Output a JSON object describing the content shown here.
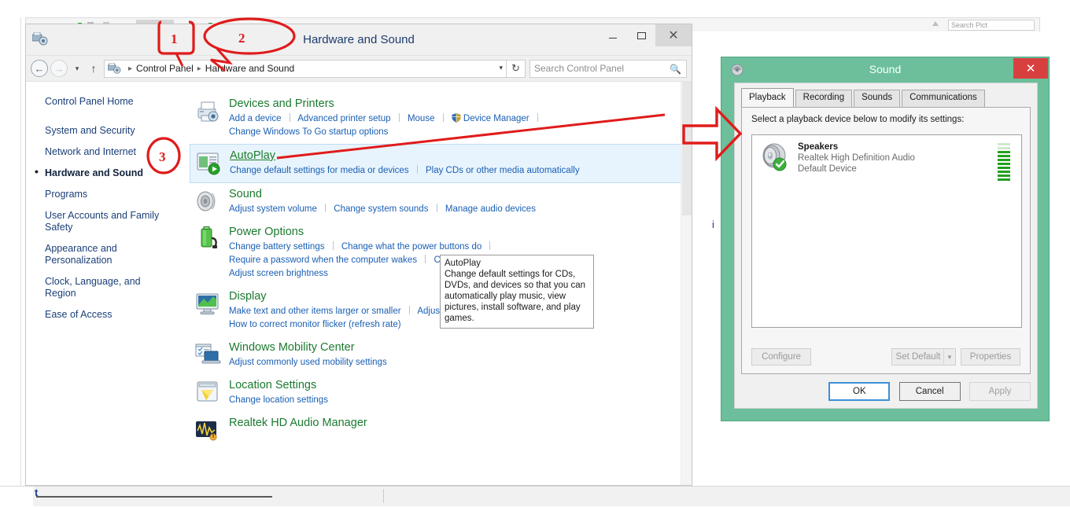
{
  "background": {
    "search_placeholder": "Search Pict",
    "fragment_text": "i"
  },
  "control_panel": {
    "title": "Hardware and Sound",
    "icon": "control-panel-icon",
    "window_buttons": {
      "minimize": "minimize-icon",
      "maximize": "maximize-icon",
      "close": "✕"
    },
    "address": {
      "back": "←",
      "forward": "→",
      "recent": "▾",
      "up": "↑",
      "icon": "control-panel-icon",
      "crumbs": [
        "Control Panel",
        "Hardware and Sound"
      ],
      "separator": "▸",
      "dropdown": "▾",
      "refresh": "↻"
    },
    "search": {
      "placeholder": "Search Control Panel",
      "icon": "search-icon"
    },
    "sidebar": {
      "home": "Control Panel Home",
      "items": [
        {
          "label": "System and Security",
          "active": false
        },
        {
          "label": "Network and Internet",
          "active": false
        },
        {
          "label": "Hardware and Sound",
          "active": true
        },
        {
          "label": "Programs",
          "active": false
        },
        {
          "label": "User Accounts and Family Safety",
          "active": false
        },
        {
          "label": "Appearance and Personalization",
          "active": false
        },
        {
          "label": "Clock, Language, and Region",
          "active": false
        },
        {
          "label": "Ease of Access",
          "active": false
        }
      ]
    },
    "categories": [
      {
        "icon": "devices-printers-icon",
        "title": "Devices and Printers",
        "highlighted": false,
        "underlined": false,
        "links_row1": [
          "Add a device",
          "Advanced printer setup",
          "Mouse",
          "Device Manager"
        ],
        "shield_on": "Device Manager",
        "links_row2": [
          "Change Windows To Go startup options"
        ]
      },
      {
        "icon": "autoplay-icon",
        "title": "AutoPlay",
        "highlighted": true,
        "underlined": true,
        "links_row1": [
          "Change default settings for media or devices",
          "Play CDs or other media automatically"
        ],
        "shield_on": "",
        "links_row2": []
      },
      {
        "icon": "sound-speaker-icon",
        "title": "Sound",
        "highlighted": false,
        "underlined": false,
        "links_row1": [
          "Adjust system volume",
          "Change system sounds",
          "Manage audio devices"
        ],
        "shield_on": "",
        "links_row2": []
      },
      {
        "icon": "power-battery-icon",
        "title": "Power Options",
        "highlighted": false,
        "underlined": false,
        "links_row1": [
          "Change battery settings",
          "Change what the power buttons do"
        ],
        "shield_on": "",
        "links_row2": [
          "Require a password when the computer wakes",
          "Change when the computer sleeps"
        ],
        "links_row3": [
          "Adjust screen brightness"
        ]
      },
      {
        "icon": "display-monitor-icon",
        "title": "Display",
        "highlighted": false,
        "underlined": false,
        "links_row1": [
          "Make text and other items larger or smaller",
          "Adjust screen resolution"
        ],
        "shield_on": "",
        "links_row2": [
          "How to correct monitor flicker (refresh rate)"
        ]
      },
      {
        "icon": "mobility-center-icon",
        "title": "Windows Mobility Center",
        "highlighted": false,
        "underlined": false,
        "links_row1": [
          "Adjust commonly used mobility settings"
        ],
        "shield_on": "",
        "links_row2": []
      },
      {
        "icon": "location-settings-icon",
        "title": "Location Settings",
        "highlighted": false,
        "underlined": false,
        "links_row1": [
          "Change location settings"
        ],
        "shield_on": "",
        "links_row2": []
      },
      {
        "icon": "realtek-audio-icon",
        "title": "Realtek HD Audio Manager",
        "highlighted": false,
        "underlined": false,
        "links_row1": [],
        "shield_on": "",
        "links_row2": []
      }
    ],
    "tooltip": {
      "title": "AutoPlay",
      "body": "Change default settings for CDs, DVDs, and devices so that you can automatically play music, view pictures, install software, and play games."
    }
  },
  "sound_dialog": {
    "title": "Sound",
    "icon": "sound-dialog-icon",
    "close": "✕",
    "titlebar_color": "#6cbf9a",
    "close_color": "#d8403f",
    "tabs": [
      {
        "label": "Playback",
        "active": true
      },
      {
        "label": "Recording",
        "active": false
      },
      {
        "label": "Sounds",
        "active": false
      },
      {
        "label": "Communications",
        "active": false
      }
    ],
    "instruction": "Select a playback device below to modify its settings:",
    "devices": [
      {
        "name": "Speakers",
        "driver": "Realtek High Definition Audio",
        "status": "Default Device",
        "icon": "speaker-icon",
        "badge": "default-check-badge",
        "meter_level": 8,
        "meter_total": 10
      }
    ],
    "panel_buttons": [
      {
        "label": "Configure",
        "enabled": false
      },
      {
        "label": "Set Default",
        "enabled": false,
        "has_dropdown": true
      },
      {
        "label": "Properties",
        "enabled": false
      }
    ],
    "footer_buttons": [
      {
        "label": "OK",
        "enabled": true,
        "primary": true
      },
      {
        "label": "Cancel",
        "enabled": true,
        "primary": false
      },
      {
        "label": "Apply",
        "enabled": false,
        "primary": false
      }
    ]
  },
  "annotations": {
    "color": "#e01b1b",
    "markers": [
      {
        "label": "1",
        "shape": "rounded-rect"
      },
      {
        "label": "2",
        "shape": "ellipse-with-pointer"
      },
      {
        "label": "3",
        "shape": "circle"
      }
    ],
    "arrow": "right-arrow-to-sound-dialog"
  }
}
